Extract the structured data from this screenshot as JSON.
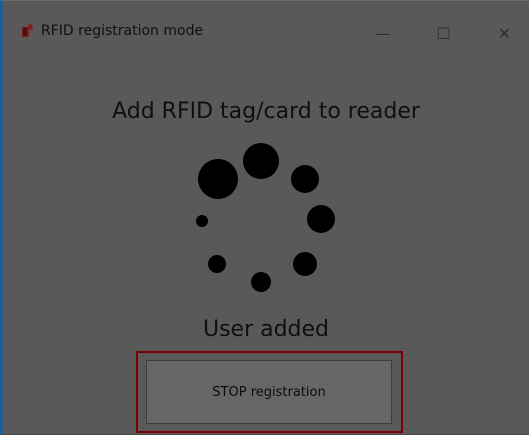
{
  "window": {
    "title": "RFID registration mode",
    "icon": "rfid-app-icon",
    "controls": {
      "minimize": "—",
      "maximize": "☐",
      "close": "✕"
    }
  },
  "main": {
    "prompt": "Add RFID tag/card to reader",
    "status": "User added",
    "stop_button_label": "STOP registration"
  },
  "colors": {
    "background": "#595959",
    "highlight_border": "#7a0000",
    "window_accent": "#1f5e93",
    "icon_red": "#8b1a1a"
  }
}
